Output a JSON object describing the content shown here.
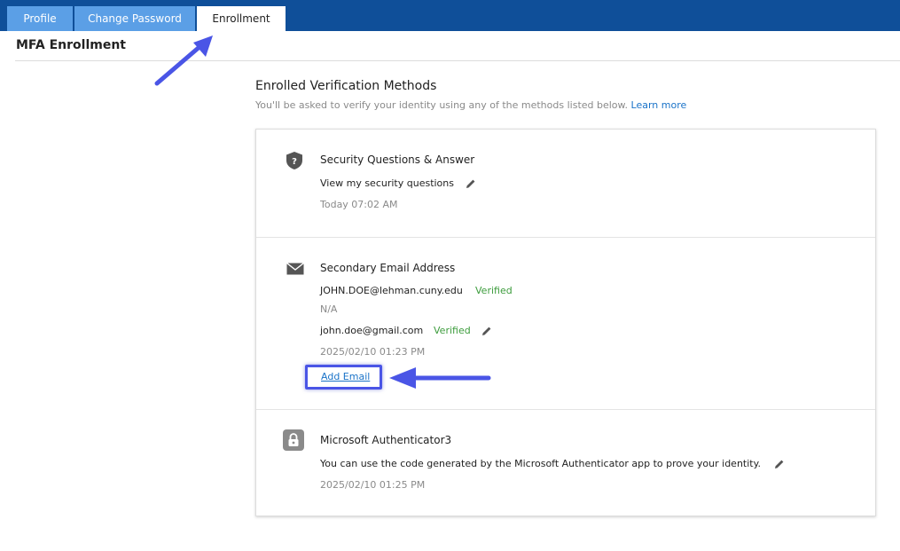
{
  "tabs": [
    {
      "label": "Profile"
    },
    {
      "label": "Change Password"
    },
    {
      "label": "Enrollment"
    }
  ],
  "page": {
    "title": "MFA Enrollment"
  },
  "section": {
    "title": "Enrolled Verification Methods",
    "description": "You'll be asked to verify your identity using any of the methods listed below.",
    "learn_more": "Learn more"
  },
  "methods": {
    "security": {
      "icon": "shield-question-icon",
      "title": "Security Questions & Answer",
      "link": "View my security questions",
      "timestamp": "Today 07:02 AM"
    },
    "email": {
      "icon": "envelope-icon",
      "title": "Secondary Email Address",
      "primary_email": "JOHN.DOE@lehman.cuny.edu",
      "primary_status": "Verified",
      "na": "N/A",
      "secondary_email": "john.doe@gmail.com",
      "secondary_status": "Verified",
      "timestamp": "2025/02/10 01:23 PM",
      "add_label": "Add Email"
    },
    "authenticator": {
      "icon": "authenticator-lock-icon",
      "title": "Microsoft Authenticator3",
      "description": "You can use the code generated by the Microsoft Authenticator app to prove your identity.",
      "timestamp": "2025/02/10 01:25 PM"
    }
  },
  "colors": {
    "header": "#0f4f99",
    "tab_inactive": "#5b9fe6",
    "link": "#1a73c8",
    "verified": "#3d9c3d",
    "annotation": "#4a55e6"
  }
}
